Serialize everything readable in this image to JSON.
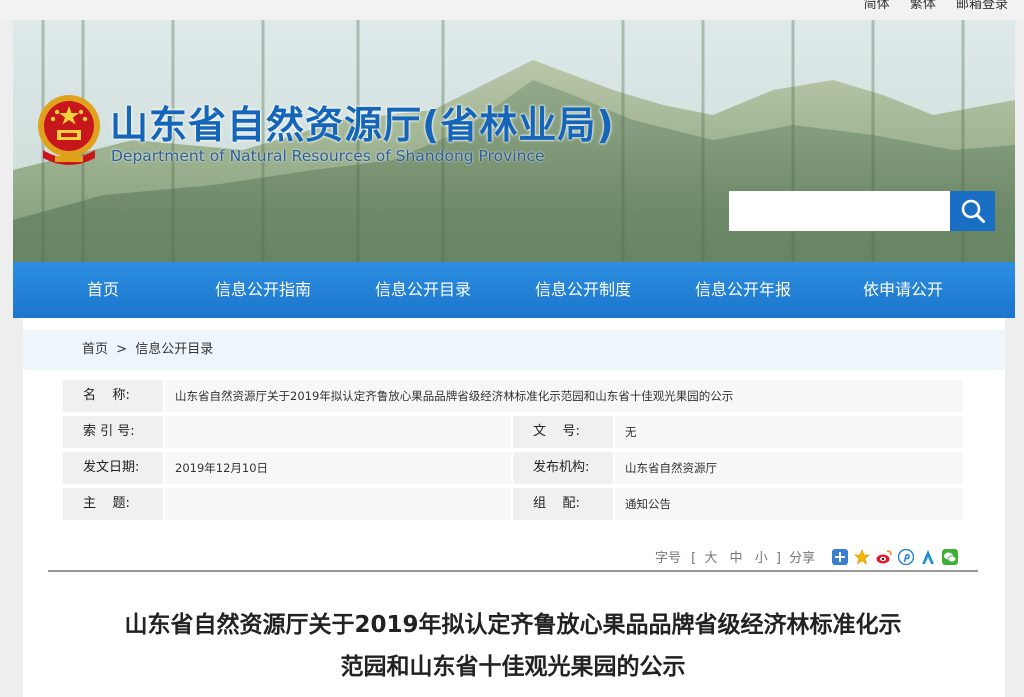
{
  "topbar": {
    "simplified": "简体",
    "traditional": "繁体",
    "mail_login": "邮箱登录"
  },
  "header": {
    "title": "山东省自然资源厅(省林业局)",
    "subtitle": "Department of Natural Resources of Shandong Province",
    "search_placeholder": "",
    "search_icon": "search-icon"
  },
  "nav": {
    "items": [
      {
        "label": "首页"
      },
      {
        "label": "信息公开指南"
      },
      {
        "label": "信息公开目录"
      },
      {
        "label": "信息公开制度"
      },
      {
        "label": "信息公开年报"
      },
      {
        "label": "依申请公开"
      }
    ]
  },
  "breadcrumb": {
    "home": "首页",
    "separator": ">",
    "current": "信息公开目录"
  },
  "meta": {
    "name_label": "名    称:",
    "name_value": "山东省自然资源厅关于2019年拟认定齐鲁放心果品品牌省级经济林标准化示范园和山东省十佳观光果园的公示",
    "index_label": "索 引 号:",
    "index_value": "",
    "docno_label": "文    号:",
    "docno_value": "无",
    "date_label": "发文日期:",
    "date_value": "2019年12月10日",
    "org_label": "发布机构:",
    "org_value": "山东省自然资源厅",
    "topic_label": "主    题:",
    "topic_value": "",
    "category_label": "组    配:",
    "category_value": "通知公告"
  },
  "tools": {
    "font_label": "字号",
    "open_bracket": "[",
    "large": "大",
    "medium": "中",
    "small": "小",
    "close_bracket": "]",
    "share_label": "分享",
    "share_icons": [
      "plus-share-icon",
      "qzone-icon",
      "weibo-icon",
      "pinterest-icon",
      "tencent-weibo-icon",
      "wechat-icon"
    ]
  },
  "article": {
    "title_line1": "山东省自然资源厅关于2019年拟认定齐鲁放心果品品牌省级经济林标准化示",
    "title_line2": "范园和山东省十佳观光果园的公示"
  },
  "colors": {
    "brand_blue": "#1a6fc4",
    "nav_blue": "#2d8fe0",
    "title_blue": "#1565b8"
  }
}
